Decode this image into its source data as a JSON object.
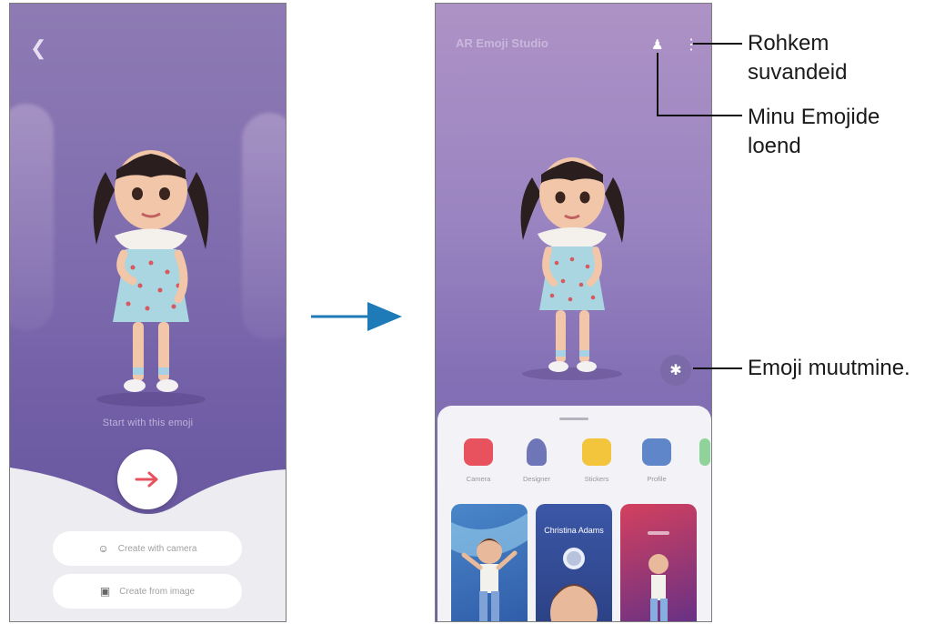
{
  "left_screen": {
    "back_icon": "chevron-left-icon",
    "intro_text": "Start with this emoji",
    "next_icon": "arrow-right-icon",
    "create_camera_label": "Create with camera",
    "create_image_label": "Create from image"
  },
  "right_screen": {
    "app_title": "AR Emoji Studio",
    "categories": [
      {
        "label": "Camera",
        "icon": "camera-icon",
        "color": "#e8525f"
      },
      {
        "label": "Designer",
        "icon": "designer-icon",
        "color": "#6f76b8"
      },
      {
        "label": "Stickers",
        "icon": "sticker-icon",
        "color": "#f2c53d"
      },
      {
        "label": "Profile",
        "icon": "profile-icon",
        "color": "#5f86c8"
      }
    ],
    "contact_card_name": "Christina Adams"
  },
  "callouts": {
    "more_options": [
      "Rohkem",
      "suvandeid"
    ],
    "my_emojis": [
      "Minu Emojide",
      "loend"
    ],
    "edit_emoji": "Emoji muutmine."
  },
  "colors": {
    "accent_red": "#e8525f",
    "arrow_blue": "#1f7ab8"
  }
}
